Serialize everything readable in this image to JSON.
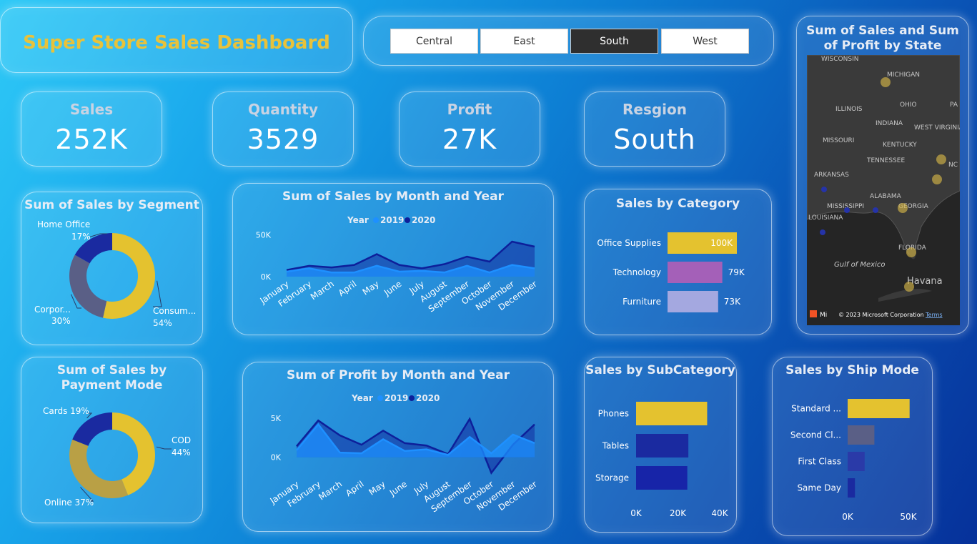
{
  "header": {
    "title": "Super Store Sales Dashboard"
  },
  "slicer": {
    "options": [
      "Central",
      "East",
      "South",
      "West"
    ],
    "selected": "South"
  },
  "kpis": {
    "sales": {
      "label": "Sales",
      "value": "252K"
    },
    "quantity": {
      "label": "Quantity",
      "value": "3529"
    },
    "profit": {
      "label": "Profit",
      "value": "27K"
    },
    "region": {
      "label": "Resgion",
      "value": "South"
    }
  },
  "map": {
    "title": "Sum of Sales and Sum of Profit by State",
    "labels": [
      "WISCONSIN",
      "MICHIGAN",
      "ILLINOIS",
      "OHIO",
      "INDIANA",
      "WEST VIRGINIA",
      "MISSOURI",
      "KENTUCKY",
      "TENNESSEE",
      "ARKANSAS",
      "ALABAMA",
      "MISSISSIPPI",
      "GEORGIA",
      "LOUISIANA",
      "FLORIDA",
      "Gulf of Mexico",
      "Havana",
      "PA",
      "NC"
    ],
    "attribution": "© 2023 Microsoft Corporation",
    "terms": "Terms",
    "logo_text": "Mi"
  },
  "colors": {
    "gold": "#e4c22f",
    "navy": "#1a2aa0",
    "slate": "#5a5f86",
    "purple": "#a460b8",
    "lavender": "#a4a8e0",
    "series2019": "#1e90ff",
    "series2020": "#0d1f9a"
  },
  "chart_data": [
    {
      "id": "segment",
      "type": "pie",
      "title": "Sum of Sales by Segment",
      "labels": [
        "Consum...",
        "Corpor...",
        "Home Office"
      ],
      "values": [
        54,
        30,
        17
      ],
      "value_labels": [
        "54%",
        "30%",
        "17%"
      ]
    },
    {
      "id": "payment",
      "type": "pie",
      "title": "Sum of Sales by Payment Mode",
      "labels": [
        "COD",
        "Online",
        "Cards"
      ],
      "values": [
        44,
        37,
        19
      ],
      "value_labels": [
        "44%",
        "37%",
        "19%"
      ]
    },
    {
      "id": "sales_month",
      "type": "area",
      "title": "Sum of Sales by Month and Year",
      "legend_title": "Year",
      "categories": [
        "January",
        "February",
        "March",
        "April",
        "May",
        "June",
        "July",
        "August",
        "September",
        "October",
        "November",
        "December"
      ],
      "series": [
        {
          "name": "2019",
          "values": [
            6000,
            10000,
            5000,
            5000,
            13000,
            6000,
            7000,
            5000,
            13000,
            5000,
            14000,
            10000
          ]
        },
        {
          "name": "2020",
          "values": [
            8000,
            13000,
            11000,
            14000,
            27000,
            14000,
            10000,
            15000,
            24000,
            18000,
            42000,
            36000
          ]
        }
      ],
      "ylim": [
        0,
        60000
      ],
      "yticks": [
        0,
        50000
      ],
      "ytick_labels": [
        "0K",
        "50K"
      ]
    },
    {
      "id": "profit_month",
      "type": "area",
      "title": "Sum of Profit by Month and Year",
      "legend_title": "Year",
      "categories": [
        "January",
        "February",
        "March",
        "April",
        "May",
        "June",
        "July",
        "August",
        "September",
        "October",
        "November",
        "December"
      ],
      "series": [
        {
          "name": "2019",
          "values": [
            900,
            4200,
            600,
            500,
            2300,
            800,
            1000,
            300,
            2600,
            500,
            2900,
            1800
          ]
        },
        {
          "name": "2020",
          "values": [
            1400,
            4700,
            2800,
            1600,
            3400,
            1800,
            1500,
            400,
            4900,
            -2000,
            1600,
            4200
          ]
        }
      ],
      "ylim": [
        -2500,
        7000
      ],
      "yticks": [
        0,
        5000
      ],
      "ytick_labels": [
        "0K",
        "5K"
      ]
    },
    {
      "id": "category",
      "type": "bar",
      "title": "Sales by Category",
      "categories": [
        "Office Supplies",
        "Technology",
        "Furniture"
      ],
      "values": [
        100000,
        79000,
        73000
      ],
      "value_labels": [
        "100K",
        "79K",
        "73K"
      ],
      "xlim": [
        0,
        100000
      ]
    },
    {
      "id": "subcategory",
      "type": "bar",
      "title": "Sales by SubCategory",
      "categories": [
        "Phones",
        "Tables",
        "Storage"
      ],
      "values": [
        34000,
        25000,
        24500
      ],
      "xlim": [
        0,
        40000
      ],
      "xticks": [
        0,
        20000,
        40000
      ],
      "xtick_labels": [
        "0K",
        "20K",
        "40K"
      ]
    },
    {
      "id": "shipmode",
      "type": "bar",
      "title": "Sales by Ship Mode",
      "categories": [
        "Standard ...",
        "Second Cl...",
        "First Class",
        "Same Day"
      ],
      "values": [
        51000,
        22000,
        14000,
        6000
      ],
      "xlim": [
        0,
        60000
      ],
      "xticks": [
        0,
        50000
      ],
      "xtick_labels": [
        "0K",
        "50K"
      ]
    }
  ]
}
